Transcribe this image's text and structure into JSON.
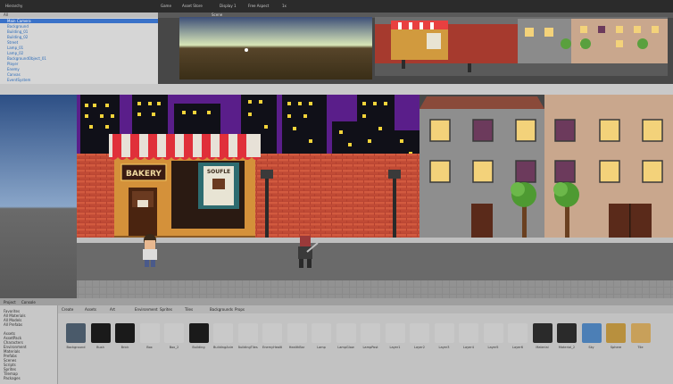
{
  "toolbar": {
    "hierarchy_tab": "Hierarchy",
    "scene_tab": "Scene",
    "game_tab": "Game",
    "asset_store_tab": "Asset Store",
    "game_view": {
      "display": "Display 1",
      "aspect": "Free Aspect",
      "scale": "1x"
    }
  },
  "hierarchy": {
    "search_placeholder": "All",
    "items": [
      {
        "label": "Main Camera"
      },
      {
        "label": "Background"
      },
      {
        "label": "Building_01"
      },
      {
        "label": "Building_02"
      },
      {
        "label": "Street"
      },
      {
        "label": "Lamp_01"
      },
      {
        "label": "Lamp_02"
      },
      {
        "label": "BackgroundObject_01"
      },
      {
        "label": "Player"
      },
      {
        "label": "Enemy"
      },
      {
        "label": "Canvas"
      },
      {
        "label": "EventSystem"
      }
    ]
  },
  "scene": {
    "shop_sign": "BAKERY",
    "poster_text": "SOUFLE"
  },
  "project": {
    "tabs": [
      "Project",
      "Console"
    ],
    "create_label": "Create",
    "tree": [
      "Favorites",
      "All Materials",
      "All Models",
      "All Prefabs",
      "",
      "Assets",
      "AssetPack",
      "Characters",
      "Environment",
      "Materials",
      "Prefabs",
      "Scenes",
      "Scripts",
      "Sprites",
      "Tilemap",
      "Packages"
    ],
    "toolbar_tabs": [
      "Assets",
      "Art",
      "Environment",
      "Sprites",
      "Tiles",
      "Backgrounds",
      "Props"
    ],
    "assets": [
      {
        "name": "Background",
        "color": "#4a5a6a"
      },
      {
        "name": "Bush",
        "color": "#1a1a1a"
      },
      {
        "name": "Brick",
        "color": "#1a1a1a"
      },
      {
        "name": "Box",
        "color": "#c9c9c9"
      },
      {
        "name": "Box_2",
        "color": "#c9c9c9"
      },
      {
        "name": "Building",
        "color": "#1a1a1a"
      },
      {
        "name": "BuildingAnim",
        "color": "#c9c9c9"
      },
      {
        "name": "BuildingTiles",
        "color": "#c9c9c9"
      },
      {
        "name": "EnemyHealth",
        "color": "#c9c9c9"
      },
      {
        "name": "HealthBar",
        "color": "#c9c9c9"
      },
      {
        "name": "Lamp",
        "color": "#c9c9c9"
      },
      {
        "name": "LampGlow",
        "color": "#c9c9c9"
      },
      {
        "name": "LampPost",
        "color": "#c9c9c9"
      },
      {
        "name": "Layer1",
        "color": "#c9c9c9"
      },
      {
        "name": "Layer2",
        "color": "#c9c9c9"
      },
      {
        "name": "Layer3",
        "color": "#c9c9c9"
      },
      {
        "name": "Layer4",
        "color": "#c9c9c9"
      },
      {
        "name": "Layer5",
        "color": "#c9c9c9"
      },
      {
        "name": "Layer6",
        "color": "#c9c9c9"
      },
      {
        "name": "Material",
        "color": "#2a2a2a"
      },
      {
        "name": "Material_2",
        "color": "#2a2a2a"
      },
      {
        "name": "Sky",
        "color": "#4c7fb6"
      },
      {
        "name": "Sphere",
        "color": "#b8903e"
      },
      {
        "name": "Tile",
        "color": "#c8a05a"
      }
    ]
  }
}
